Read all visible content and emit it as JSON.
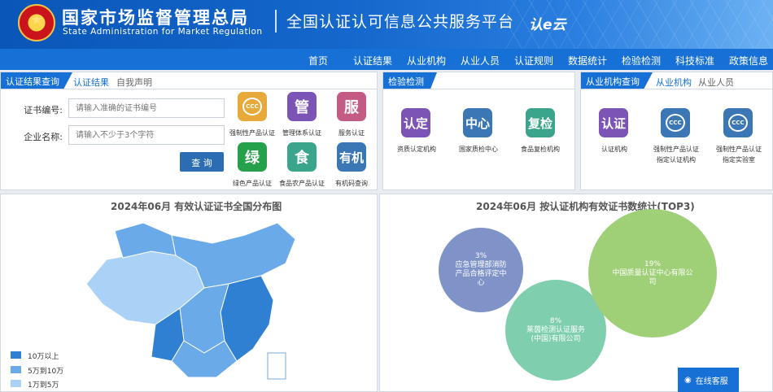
{
  "header": {
    "emblem_glyph": "★",
    "title_cn": "国家市场监督管理总局",
    "title_en": "State Administration for Market Regulation",
    "platform": "全国认证认可信息公共服务平台",
    "brand_mark": "认e云"
  },
  "nav": [
    "首页",
    "认证结果",
    "从业机构",
    "从业人员",
    "认证规则",
    "数据统计",
    "检验检测",
    "科技标准",
    "政策信息"
  ],
  "cert_panel": {
    "tab_active": "认证结果查询",
    "tabs": [
      "认证结果",
      "自我声明"
    ],
    "cert_label": "证书编号:",
    "cert_placeholder": "请输入准确的证书编号",
    "company_label": "企业名称:",
    "company_placeholder": "请输入不少于3个字符",
    "query_button": "查 询",
    "tiles": [
      {
        "glyph": "CCC",
        "caption": "强制性产品认证",
        "color": "#e6a93a"
      },
      {
        "glyph": "管",
        "caption": "管理体系认证",
        "color": "#7b54b6"
      },
      {
        "glyph": "服",
        "caption": "服务认证",
        "color": "#c35b84"
      },
      {
        "glyph": "绿",
        "caption": "绿色产品认证",
        "color": "#24a14a"
      },
      {
        "glyph": "食",
        "caption": "食品农产品认证",
        "color": "#3aa58a"
      },
      {
        "glyph": "有机",
        "caption": "有机码查询",
        "color": "#3a77b4"
      }
    ]
  },
  "inspect_panel": {
    "tab_active": "检验检测",
    "tiles": [
      {
        "glyph": "认定",
        "caption": "资质认定机构",
        "color": "#7b54b6"
      },
      {
        "glyph": "中心",
        "caption": "国家质检中心",
        "color": "#3a77b4"
      },
      {
        "glyph": "复检",
        "caption": "食品复检机构",
        "color": "#3aa58a"
      }
    ]
  },
  "org_panel": {
    "tab_active": "从业机构查询",
    "tabs": [
      "从业机构",
      "从业人员"
    ],
    "tiles": [
      {
        "glyph": "认证",
        "caption": "认证机构",
        "color": "#7b54b6"
      },
      {
        "glyph": "CCC",
        "caption": "强制性产品认证指定认证机构",
        "color": "#3a77b4"
      },
      {
        "glyph": "CCC",
        "caption": "强制性产品认证指定实验室",
        "color": "#3a77b4"
      }
    ]
  },
  "map_chart": {
    "title": "2024年06月  有效认证证书全国分布图",
    "legend": [
      {
        "label": "10万以上",
        "color": "#2f7fd3"
      },
      {
        "label": "5万到10万",
        "color": "#6aaae8"
      },
      {
        "label": "1万到5万",
        "color": "#a9d2f6"
      }
    ]
  },
  "chart_data": {
    "type": "bubble",
    "title": "2024年06月  按认证机构有效证书数统计(TOP3)",
    "series": [
      {
        "name": "应急管理部消防产品合格评定中心",
        "value_pct": 3,
        "color": "#7f93c9"
      },
      {
        "name": "莱茵检测认证服务(中国)有限公司",
        "value_pct": 8,
        "color": "#7fcfae"
      },
      {
        "name": "中国质量认证中心有限公司",
        "value_pct": 19,
        "color": "#9fcf77"
      }
    ]
  },
  "chat": {
    "label": "在线客服"
  }
}
